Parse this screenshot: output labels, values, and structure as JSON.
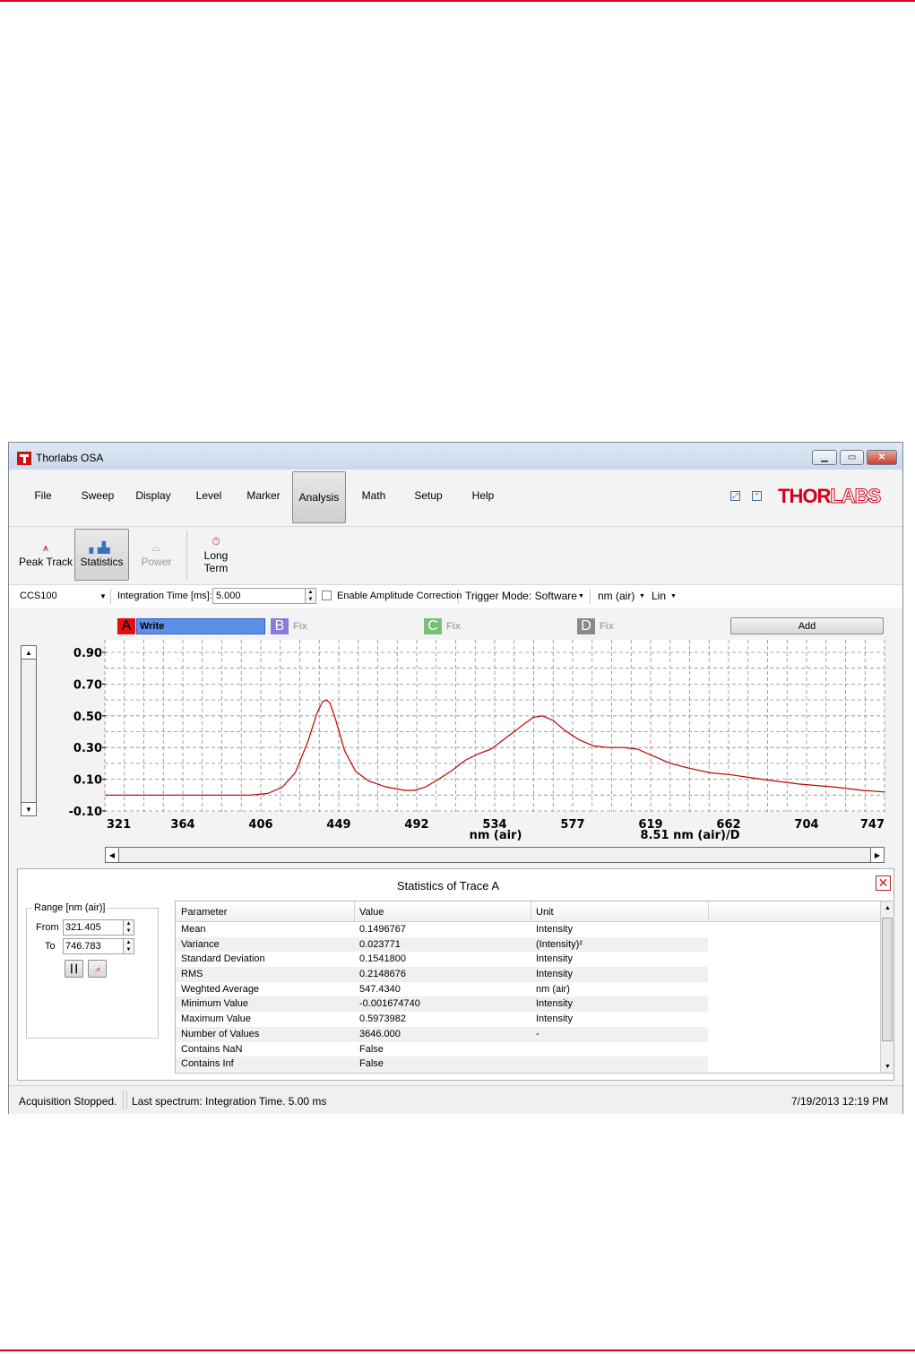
{
  "window": {
    "title": "Thorlabs OSA",
    "logo_text": "THOR",
    "logo_text2": "LABS"
  },
  "menu": [
    "File",
    "Sweep",
    "Display",
    "Level",
    "Marker",
    "Analysis",
    "Math",
    "Setup",
    "Help"
  ],
  "menu_active": "Analysis",
  "ribbon": {
    "peak_track": "Peak Track",
    "statistics": "Statistics",
    "power": "Power",
    "long_term_1": "Long",
    "long_term_2": "Term"
  },
  "toolbar": {
    "device": "CCS100",
    "integration_label": "Integration Time [ms]:",
    "integration_value": "5.000",
    "amplitude_correction": "Enable Amplitude Correction",
    "trigger_mode": "Trigger Mode: Software",
    "unit": "nm (air)",
    "scale": "Lin"
  },
  "traces": {
    "a_letter": "A",
    "a_label": "Write",
    "b_letter": "B",
    "b_label": "Fix",
    "c_letter": "C",
    "c_label": "Fix",
    "d_letter": "D",
    "d_label": "Fix",
    "add": "Add"
  },
  "chart_data": {
    "type": "line",
    "xlabel": "nm (air)",
    "x_scale_label": "8.51 nm (air)/D",
    "x_ticks": [
      "321",
      "364",
      "406",
      "449",
      "492",
      "534",
      "577",
      "619",
      "662",
      "704",
      "747"
    ],
    "y_ticks": [
      "0.90",
      "0.70",
      "0.50",
      "0.30",
      "0.10",
      "-0.10"
    ],
    "xlim": [
      321,
      747
    ],
    "ylim": [
      -0.15,
      0.92
    ],
    "grid": true,
    "color": "#c00000",
    "series": [
      {
        "x": [
          321,
          350,
          380,
          400,
          410,
          418,
          425,
          432,
          437,
          440,
          442,
          444,
          447,
          452,
          458,
          465,
          475,
          485,
          490,
          496,
          502,
          510,
          518,
          525,
          532,
          540,
          548,
          555,
          560,
          566,
          572,
          580,
          588,
          596,
          604,
          612,
          620,
          630,
          640,
          652,
          662,
          680,
          700,
          720,
          735,
          747
        ],
        "y": [
          0.0,
          0.0,
          0.0,
          0.0,
          0.01,
          0.05,
          0.14,
          0.34,
          0.52,
          0.59,
          0.6,
          0.58,
          0.48,
          0.28,
          0.15,
          0.09,
          0.05,
          0.03,
          0.03,
          0.05,
          0.09,
          0.15,
          0.22,
          0.26,
          0.29,
          0.36,
          0.43,
          0.49,
          0.5,
          0.47,
          0.41,
          0.35,
          0.31,
          0.3,
          0.3,
          0.29,
          0.25,
          0.2,
          0.17,
          0.14,
          0.13,
          0.1,
          0.07,
          0.05,
          0.03,
          0.02
        ]
      }
    ]
  },
  "stats": {
    "title": "Statistics of Trace A",
    "range_label": "Range [nm (air)]",
    "from_label": "From",
    "from_value": "321.405",
    "to_label": "To",
    "to_value": "746.783",
    "headers": [
      "Parameter",
      "Value",
      "Unit"
    ],
    "rows": [
      [
        "Mean",
        "0.1496767",
        "Intensity"
      ],
      [
        "Variance",
        "0.023771",
        "(Intensity)²"
      ],
      [
        "Standard Deviation",
        "0.1541800",
        "Intensity"
      ],
      [
        "RMS",
        "0.2148676",
        "Intensity"
      ],
      [
        "Weghted Average",
        "547.4340",
        "nm (air)"
      ],
      [
        "Minimum Value",
        "-0.001674740",
        "Intensity"
      ],
      [
        "Maximum Value",
        "0.5973982",
        "Intensity"
      ],
      [
        "Number of Values",
        "3646.000",
        "-"
      ],
      [
        "Contains NaN",
        "False",
        ""
      ],
      [
        "Contains Inf",
        "False",
        ""
      ]
    ]
  },
  "status": {
    "acquisition": "Acquisition Stopped.",
    "last_spectrum": "Last spectrum: Integration Time. 5.00 ms",
    "timestamp": "7/19/2013 12:19 PM"
  }
}
